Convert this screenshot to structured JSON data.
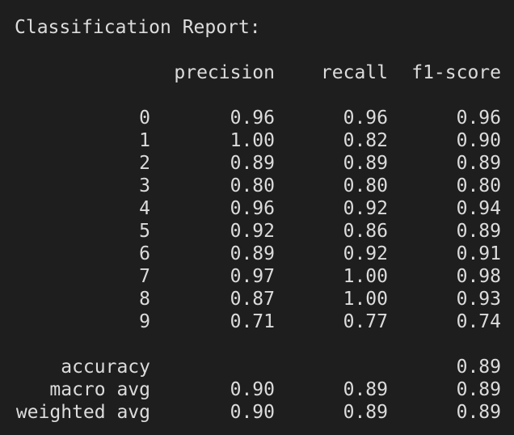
{
  "report": {
    "title": "Classification Report:",
    "columns": [
      "precision",
      "recall",
      "f1-score"
    ],
    "rows": [
      {
        "label": "0",
        "precision": "0.96",
        "recall": "0.96",
        "f1": "0.96"
      },
      {
        "label": "1",
        "precision": "1.00",
        "recall": "0.82",
        "f1": "0.90"
      },
      {
        "label": "2",
        "precision": "0.89",
        "recall": "0.89",
        "f1": "0.89"
      },
      {
        "label": "3",
        "precision": "0.80",
        "recall": "0.80",
        "f1": "0.80"
      },
      {
        "label": "4",
        "precision": "0.96",
        "recall": "0.92",
        "f1": "0.94"
      },
      {
        "label": "5",
        "precision": "0.92",
        "recall": "0.86",
        "f1": "0.89"
      },
      {
        "label": "6",
        "precision": "0.89",
        "recall": "0.92",
        "f1": "0.91"
      },
      {
        "label": "7",
        "precision": "0.97",
        "recall": "1.00",
        "f1": "0.98"
      },
      {
        "label": "8",
        "precision": "0.87",
        "recall": "1.00",
        "f1": "0.93"
      },
      {
        "label": "9",
        "precision": "0.71",
        "recall": "0.77",
        "f1": "0.74"
      }
    ],
    "summary": [
      {
        "label": "accuracy",
        "precision": "",
        "recall": "",
        "f1": "0.89"
      },
      {
        "label": "macro avg",
        "precision": "0.90",
        "recall": "0.89",
        "f1": "0.89"
      },
      {
        "label": "weighted avg",
        "precision": "0.90",
        "recall": "0.89",
        "f1": "0.89"
      }
    ]
  }
}
